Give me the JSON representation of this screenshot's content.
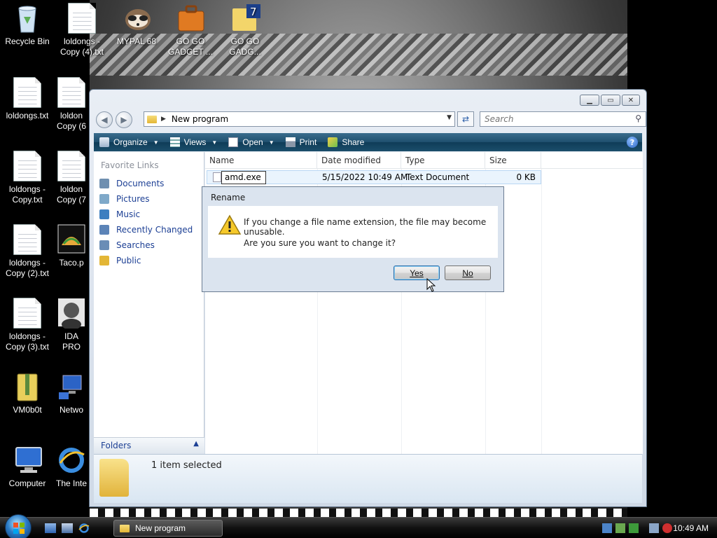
{
  "desktop": {
    "icons": [
      {
        "label": "Recycle Bin",
        "icon": "recycle-bin-icon"
      },
      {
        "label": "loldongs - Copy (4).txt",
        "icon": "text-document-icon"
      },
      {
        "label": "MYPAL 68",
        "icon": "raccoon-browser-icon"
      },
      {
        "label": "GO GO GADGET ...",
        "icon": "briefcase-icon"
      },
      {
        "label": "GO GO GADG...",
        "icon": "7zip-archive-icon"
      },
      {
        "label": "loldongs.txt",
        "icon": "text-document-icon"
      },
      {
        "label": "loldon Copy (6",
        "icon": "text-document-icon"
      },
      {
        "label": "loldongs - Copy.txt",
        "icon": "text-document-icon"
      },
      {
        "label": "loldon Copy (7",
        "icon": "text-document-icon"
      },
      {
        "label": "loldongs - Copy (2).txt",
        "icon": "text-document-icon"
      },
      {
        "label": "Taco.p",
        "icon": "taco-image-icon"
      },
      {
        "label": "loldongs - Copy (3).txt",
        "icon": "text-document-icon"
      },
      {
        "label": "IDA PRO",
        "icon": "ida-pro-icon"
      },
      {
        "label": "VM0b0t",
        "icon": "zip-folder-icon"
      },
      {
        "label": "Netwo",
        "icon": "network-icon"
      },
      {
        "label": "Computer",
        "icon": "computer-icon"
      },
      {
        "label": "The Inte",
        "icon": "internet-explorer-icon"
      }
    ]
  },
  "explorer": {
    "address": {
      "folder": "New program"
    },
    "search": {
      "placeholder": "Search"
    },
    "toolbar": {
      "organize": "Organize",
      "views": "Views",
      "open": "Open",
      "print": "Print",
      "share": "Share"
    },
    "nav": {
      "title": "Favorite Links",
      "items": [
        {
          "label": "Documents",
          "color": "#6f8fb0"
        },
        {
          "label": "Pictures",
          "color": "#7fa9c9"
        },
        {
          "label": "Music",
          "color": "#3d7fc0"
        },
        {
          "label": "Recently Changed",
          "color": "#5c84b8"
        },
        {
          "label": "Searches",
          "color": "#6a8db6"
        },
        {
          "label": "Public",
          "color": "#e3b636"
        }
      ],
      "folders": "Folders"
    },
    "columns": {
      "name": "Name",
      "date": "Date modified",
      "type": "Type",
      "size": "Size"
    },
    "file": {
      "name": "amd.exe",
      "date": "5/15/2022 10:49 AM",
      "type": "Text Document",
      "size": "0 KB"
    },
    "details": {
      "status": "1 item selected"
    }
  },
  "dialog": {
    "title": "Rename",
    "line1": "If you change a file name extension, the file may become unusable.",
    "line2": "Are you sure you want to change it?",
    "yes": "Yes",
    "no": "No"
  },
  "taskbar": {
    "task": "New program",
    "clock": "10:49 AM"
  },
  "colors": {
    "accent": "#1c3f94",
    "toolbar": "#1f4f6e"
  }
}
